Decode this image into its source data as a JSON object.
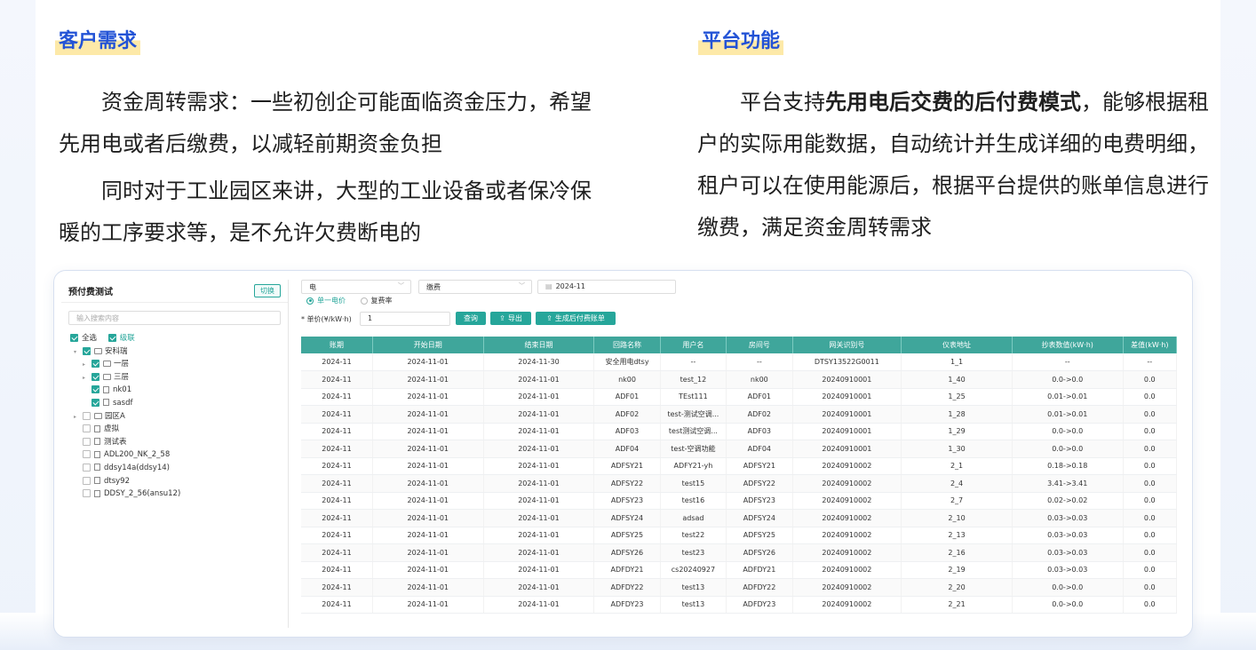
{
  "left_section": {
    "title": "客户需求",
    "para1": "资金周转需求：一些初创企可能面临资金压力，希望先用电或者后缴费，以减轻前期资金负担",
    "para2": "同时对于工业园区来讲，大型的工业设备或者保冷保暖的工序要求等，是不允许欠费断电的"
  },
  "right_section": {
    "title": "平台功能",
    "para_prefix": "平台支持",
    "para_bold": "先用电后交费的后付费模式",
    "para_suffix": "，能够根据租户的实际用能数据，自动统计并生成详细的电费明细，租户可以在使用能源后，根据平台提供的账单信息进行缴费，满足资金周转需求"
  },
  "app": {
    "left": {
      "title": "预付费测试",
      "switch_label": "切换",
      "search_placeholder": "输入搜索内容",
      "select_all": "全选",
      "cascade": "级联",
      "tree": [
        {
          "label": "安科瑞",
          "level": 0,
          "checked": true,
          "expand": true,
          "type": "folder"
        },
        {
          "label": "一层",
          "level": 1,
          "checked": true,
          "expand": false,
          "type": "folder"
        },
        {
          "label": "三层",
          "level": 1,
          "checked": true,
          "expand": false,
          "type": "folder"
        },
        {
          "label": "nk01",
          "level": 1,
          "checked": true,
          "expand": null,
          "type": "doc"
        },
        {
          "label": "sasdf",
          "level": 1,
          "checked": true,
          "expand": null,
          "type": "doc"
        },
        {
          "label": "园区A",
          "level": 0,
          "checked": false,
          "expand": false,
          "type": "folder"
        },
        {
          "label": "虚拟",
          "level": 0,
          "checked": false,
          "expand": null,
          "type": "doc"
        },
        {
          "label": "测试表",
          "level": 0,
          "checked": false,
          "expand": null,
          "type": "doc"
        },
        {
          "label": "ADL200_NK_2_58",
          "level": 0,
          "checked": false,
          "expand": null,
          "type": "doc"
        },
        {
          "label": "ddsy14a(ddsy14)",
          "level": 0,
          "checked": false,
          "expand": null,
          "type": "doc"
        },
        {
          "label": "dtsy92",
          "level": 0,
          "checked": false,
          "expand": null,
          "type": "doc"
        },
        {
          "label": "DDSY_2_56(ansu12)",
          "level": 0,
          "checked": false,
          "expand": null,
          "type": "doc"
        }
      ]
    },
    "right": {
      "energy_select": "电",
      "type_select": "缴费",
      "date_value": "2024-11",
      "radio_single": "单一电价",
      "radio_multi": "复费率",
      "price_label": "* 单价(¥/kW·h)",
      "price_value": "1",
      "btn_query": "查询",
      "btn_export": "导出",
      "btn_generate": "生成后付费账单",
      "columns": [
        "账期",
        "开始日期",
        "结束日期",
        "回路名称",
        "用户名",
        "房间号",
        "网关识别号",
        "仪表地址",
        "抄表数值(kW·h)",
        "差值(kW·h)"
      ],
      "rows": [
        [
          "2024-11",
          "2024-11-01",
          "2024-11-30",
          "安全用电dtsy",
          "--",
          "--",
          "DTSY13522G0011",
          "1_1",
          "--",
          "--"
        ],
        [
          "2024-11",
          "2024-11-01",
          "2024-11-01",
          "nk00",
          "test_12",
          "nk00",
          "20240910001",
          "1_40",
          "0.0->0.0",
          "0.0"
        ],
        [
          "2024-11",
          "2024-11-01",
          "2024-11-01",
          "ADF01",
          "TEst111",
          "ADF01",
          "20240910001",
          "1_25",
          "0.01->0.01",
          "0.0"
        ],
        [
          "2024-11",
          "2024-11-01",
          "2024-11-01",
          "ADF02",
          "test-测试空调...",
          "ADF02",
          "20240910001",
          "1_28",
          "0.01->0.01",
          "0.0"
        ],
        [
          "2024-11",
          "2024-11-01",
          "2024-11-01",
          "ADF03",
          "test测试空调...",
          "ADF03",
          "20240910001",
          "1_29",
          "0.0->0.0",
          "0.0"
        ],
        [
          "2024-11",
          "2024-11-01",
          "2024-11-01",
          "ADF04",
          "test-空调功能",
          "ADF04",
          "20240910001",
          "1_30",
          "0.0->0.0",
          "0.0"
        ],
        [
          "2024-11",
          "2024-11-01",
          "2024-11-01",
          "ADFSY21",
          "ADFY21-yh",
          "ADFSY21",
          "20240910002",
          "2_1",
          "0.18->0.18",
          "0.0"
        ],
        [
          "2024-11",
          "2024-11-01",
          "2024-11-01",
          "ADFSY22",
          "test15",
          "ADFSY22",
          "20240910002",
          "2_4",
          "3.41->3.41",
          "0.0"
        ],
        [
          "2024-11",
          "2024-11-01",
          "2024-11-01",
          "ADFSY23",
          "test16",
          "ADFSY23",
          "20240910002",
          "2_7",
          "0.02->0.02",
          "0.0"
        ],
        [
          "2024-11",
          "2024-11-01",
          "2024-11-01",
          "ADFSY24",
          "adsad",
          "ADFSY24",
          "20240910002",
          "2_10",
          "0.03->0.03",
          "0.0"
        ],
        [
          "2024-11",
          "2024-11-01",
          "2024-11-01",
          "ADFSY25",
          "test22",
          "ADFSY25",
          "20240910002",
          "2_13",
          "0.03->0.03",
          "0.0"
        ],
        [
          "2024-11",
          "2024-11-01",
          "2024-11-01",
          "ADFSY26",
          "test23",
          "ADFSY26",
          "20240910002",
          "2_16",
          "0.03->0.03",
          "0.0"
        ],
        [
          "2024-11",
          "2024-11-01",
          "2024-11-01",
          "ADFDY21",
          "cs20240927",
          "ADFDY21",
          "20240910002",
          "2_19",
          "0.03->0.03",
          "0.0"
        ],
        [
          "2024-11",
          "2024-11-01",
          "2024-11-01",
          "ADFDY22",
          "test13",
          "ADFDY22",
          "20240910002",
          "2_20",
          "0.0->0.0",
          "0.0"
        ],
        [
          "2024-11",
          "2024-11-01",
          "2024-11-01",
          "ADFDY23",
          "test13",
          "ADFDY23",
          "20240910002",
          "2_21",
          "0.0->0.0",
          "0.0"
        ]
      ]
    }
  },
  "colors": {
    "title": "#2353d6",
    "highlight": "#fde9a8",
    "teal": "#26a69a",
    "header": "#3fa69b"
  }
}
